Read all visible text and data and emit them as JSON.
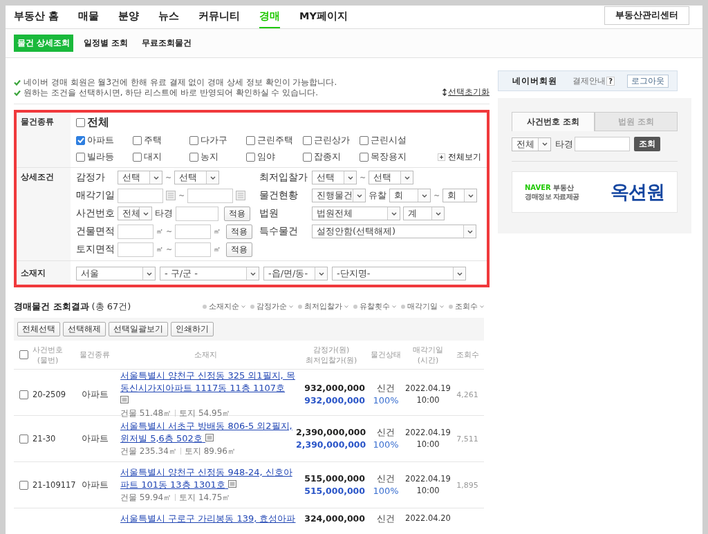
{
  "nav": {
    "tabs": [
      {
        "label": "부동산 홈",
        "selected": false
      },
      {
        "label": "매물",
        "selected": false
      },
      {
        "label": "분양",
        "selected": false
      },
      {
        "label": "뉴스",
        "selected": false
      },
      {
        "label": "커뮤니티",
        "selected": false
      },
      {
        "label": "경매",
        "selected": true
      },
      {
        "label": "MY페이지",
        "selected": false
      }
    ],
    "center_button": "부동산관리센터"
  },
  "subnav": {
    "tabs": [
      {
        "label": "물건 상세조회",
        "selected": true
      },
      {
        "label": "일정별 조회",
        "selected": false
      },
      {
        "label": "무료조회물건",
        "selected": false
      }
    ]
  },
  "notices": [
    "네이버 경매 회원은 월3건에 한해 유료 결제 없이 경매 상세 정보 확인이 가능합니다.",
    "원하는 조건을 선택하시면, 하단 리스트에 바로 반영되어 확인하실 수 있습니다."
  ],
  "reset_link": "선택초기화",
  "filter": {
    "highlighted": true,
    "type_label": "물건종류",
    "all": {
      "label": "전체",
      "checked": false
    },
    "types": [
      {
        "label": "아파트",
        "checked": true
      },
      {
        "label": "주택",
        "checked": false
      },
      {
        "label": "다가구",
        "checked": false
      },
      {
        "label": "근린주택",
        "checked": false
      },
      {
        "label": "근린상가",
        "checked": false
      },
      {
        "label": "근린시설",
        "checked": false
      },
      {
        "label": "빌라등",
        "checked": false
      },
      {
        "label": "대지",
        "checked": false
      },
      {
        "label": "농지",
        "checked": false
      },
      {
        "label": "임야",
        "checked": false
      },
      {
        "label": "잡종지",
        "checked": false
      },
      {
        "label": "목장용지",
        "checked": false
      }
    ],
    "show_all": "전체보기",
    "detail_label": "상세조건",
    "conditions": [
      {
        "kind": "select-range",
        "label": "감정가",
        "from": "선택",
        "sep": "~",
        "to": "선택"
      },
      {
        "kind": "select-range",
        "label": "최저입찰가",
        "from": "선택",
        "sep": "~",
        "to": "선택"
      },
      {
        "kind": "date-range",
        "label": "매각기일",
        "sep": "~"
      },
      {
        "kind": "status",
        "label": "물건현황",
        "value": "진행물건",
        "sub_label": "유찰",
        "from": "회",
        "sep": "~",
        "to": "회"
      },
      {
        "kind": "case",
        "label": "사건번호",
        "value": "전체",
        "field_label": "타경",
        "button": "적용"
      },
      {
        "kind": "select-pair",
        "label": "법원",
        "value": "법원전체",
        "second": "계"
      },
      {
        "kind": "area-range",
        "label": "건물면적",
        "unit": "㎡",
        "sep": "~",
        "button": "적용"
      },
      {
        "kind": "select",
        "label": "특수물건",
        "value": "설정안함(선택해제)"
      },
      {
        "kind": "area-range",
        "label": "토지면적",
        "unit": "㎡",
        "sep": "~",
        "button": "적용"
      }
    ],
    "location_label": "소재지",
    "locations": [
      "서울",
      "- 구/군 -",
      "-읍/면/동-",
      "-단지명-"
    ]
  },
  "results": {
    "title": "경매물건 조회결과",
    "count": "(총 67건)",
    "sorts": [
      "소재지순",
      "감정가순",
      "최저입찰가",
      "유찰횟수",
      "매각기일",
      "조회수"
    ],
    "actions": [
      "전체선택",
      "선택해제",
      "선택일괄보기",
      "인쇄하기"
    ],
    "header_checked": false,
    "columns": [
      "사건번호\n(물번)",
      "물건종류",
      "소재지",
      "감정가(원)\n최저입찰가(원)",
      "물건상태",
      "매각기일\n(시간)",
      "조회수"
    ],
    "rows": [
      {
        "checked": false,
        "case": "20-2509",
        "type": "아파트",
        "address": "서울특별시 양천구 신정동 325 외1필지, 목동신시가지아파트 1117동 11층 1107호",
        "building": "건물 51.48㎡",
        "land": "토지 54.95㎡",
        "appraisal": "932,000,000",
        "minimum": "932,000,000",
        "status": "신건",
        "ratio": "100%",
        "date": "2022.04.19\n10:00",
        "views": "4,261"
      },
      {
        "checked": false,
        "case": "21-30",
        "type": "아파트",
        "address": "서울특별시 서초구 방배동 806-5 외2필지, 윈저빌 5,6층 502호",
        "building": "건물 235.34㎡",
        "land": "토지 89.96㎡",
        "appraisal": "2,390,000,000",
        "minimum": "2,390,000,000",
        "status": "신건",
        "ratio": "100%",
        "date": "2022.04.19\n10:00",
        "views": "7,511"
      },
      {
        "checked": false,
        "case": "21-109117",
        "type": "아파트",
        "address": "서울특별시 양천구 신정동 948-24, 신호아파트 101동 13층 1301호",
        "building": "건물 59.94㎡",
        "land": "토지 14.75㎡",
        "appraisal": "515,000,000",
        "minimum": "515,000,000",
        "status": "신건",
        "ratio": "100%",
        "date": "2022.04.19\n10:00",
        "views": "1,895"
      },
      {
        "address": "서울특별시 구로구 가리봉동 139, 효성아파",
        "appraisal": "324,000,000",
        "status": "신건",
        "date": "2022.04.20"
      }
    ]
  },
  "side": {
    "member": {
      "name": "네이버회원",
      "payment": "결제안내",
      "help": "?",
      "logout": "로그아웃"
    },
    "tabs": [
      {
        "label": "사건번호 조회",
        "selected": true
      },
      {
        "label": "법원 조회",
        "selected": false
      }
    ],
    "search": {
      "value": "전체",
      "label": "타경",
      "button": "조회"
    },
    "banner": {
      "brand": "NAVER",
      "brand_suffix": "부동산",
      "caption": "경매정보 자료제공",
      "logo": "옥션원"
    }
  }
}
